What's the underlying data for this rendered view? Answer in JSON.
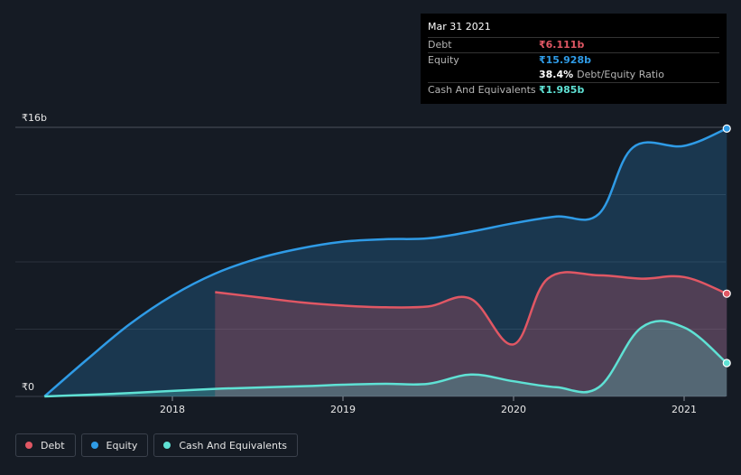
{
  "chart_data": {
    "type": "area",
    "yticks": [
      {
        "value": 0,
        "label": "₹0"
      },
      {
        "value": 16,
        "label": "₹16b"
      }
    ],
    "xticks": [
      {
        "value": 2018,
        "label": "2018"
      },
      {
        "value": 2019,
        "label": "2019"
      },
      {
        "value": 2020,
        "label": "2020"
      },
      {
        "value": 2021,
        "label": "2021"
      }
    ],
    "xlim": [
      2017.0,
      2021.25
    ],
    "ylim": [
      0,
      16
    ],
    "grid": true,
    "series": [
      {
        "name": "Equity",
        "color": "#2f9be6",
        "points": [
          [
            2017.25,
            0.0
          ],
          [
            2017.5,
            2.2
          ],
          [
            2017.75,
            4.3
          ],
          [
            2018.0,
            6.0
          ],
          [
            2018.25,
            7.3
          ],
          [
            2018.5,
            8.2
          ],
          [
            2018.75,
            8.8
          ],
          [
            2019.0,
            9.2
          ],
          [
            2019.25,
            9.35
          ],
          [
            2019.5,
            9.4
          ],
          [
            2019.75,
            9.8
          ],
          [
            2020.0,
            10.3
          ],
          [
            2020.25,
            10.7
          ],
          [
            2020.5,
            10.85
          ],
          [
            2020.7,
            14.8
          ],
          [
            2021.0,
            14.9
          ],
          [
            2021.25,
            15.928
          ]
        ]
      },
      {
        "name": "Debt",
        "color": "#e05764",
        "points": [
          [
            2018.25,
            6.2
          ],
          [
            2018.5,
            5.9
          ],
          [
            2018.75,
            5.6
          ],
          [
            2019.0,
            5.4
          ],
          [
            2019.25,
            5.3
          ],
          [
            2019.5,
            5.35
          ],
          [
            2019.75,
            5.8
          ],
          [
            2020.0,
            3.1
          ],
          [
            2020.2,
            7.0
          ],
          [
            2020.5,
            7.2
          ],
          [
            2020.75,
            7.0
          ],
          [
            2021.0,
            7.1
          ],
          [
            2021.25,
            6.111
          ]
        ]
      },
      {
        "name": "Cash And Equivalents",
        "color": "#5fe1d4",
        "points": [
          [
            2017.25,
            0.0
          ],
          [
            2017.75,
            0.2
          ],
          [
            2018.25,
            0.45
          ],
          [
            2018.75,
            0.6
          ],
          [
            2019.0,
            0.7
          ],
          [
            2019.25,
            0.75
          ],
          [
            2019.5,
            0.75
          ],
          [
            2019.75,
            1.3
          ],
          [
            2020.0,
            0.9
          ],
          [
            2020.25,
            0.55
          ],
          [
            2020.5,
            0.55
          ],
          [
            2020.75,
            4.1
          ],
          [
            2021.0,
            4.1
          ],
          [
            2021.25,
            1.985
          ]
        ]
      }
    ]
  },
  "tooltip": {
    "date": "Mar 31 2021",
    "rows": [
      {
        "label": "Debt",
        "value": "₹6.111b",
        "color": "#e05764"
      },
      {
        "label": "Equity",
        "value": "₹15.928b",
        "color": "#2f9be6"
      },
      {
        "label": "",
        "ratio": "38.4%",
        "ratio_label": "Debt/Equity Ratio"
      },
      {
        "label": "Cash And Equivalents",
        "value": "₹1.985b",
        "color": "#5fe1d4"
      }
    ]
  },
  "legend": [
    {
      "label": "Debt",
      "color": "#e05764"
    },
    {
      "label": "Equity",
      "color": "#2f9be6"
    },
    {
      "label": "Cash And Equivalents",
      "color": "#5fe1d4"
    }
  ]
}
